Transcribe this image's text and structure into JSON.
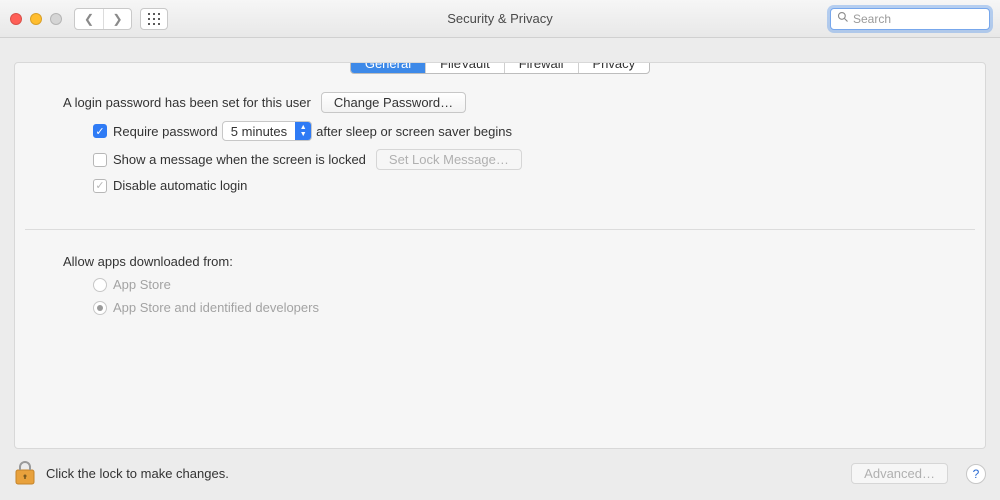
{
  "window": {
    "title": "Security & Privacy",
    "search_placeholder": "Search"
  },
  "tabs": [
    {
      "label": "General",
      "active": true
    },
    {
      "label": "FileVault",
      "active": false
    },
    {
      "label": "Firewall",
      "active": false
    },
    {
      "label": "Privacy",
      "active": false
    }
  ],
  "login": {
    "password_set_text": "A login password has been set for this user",
    "change_password_btn": "Change Password…",
    "require_password_label_pre": "Require password",
    "require_password_label_post": "after sleep or screen saver begins",
    "require_password_value": "5 minutes",
    "show_message_label": "Show a message when the screen is locked",
    "set_lock_message_btn": "Set Lock Message…",
    "disable_auto_login_label": "Disable automatic login"
  },
  "apps": {
    "heading": "Allow apps downloaded from:",
    "options": [
      {
        "label": "App Store",
        "selected": false
      },
      {
        "label": "App Store and identified developers",
        "selected": true
      }
    ]
  },
  "footer": {
    "lock_text": "Click the lock to make changes.",
    "advanced_btn": "Advanced…"
  }
}
